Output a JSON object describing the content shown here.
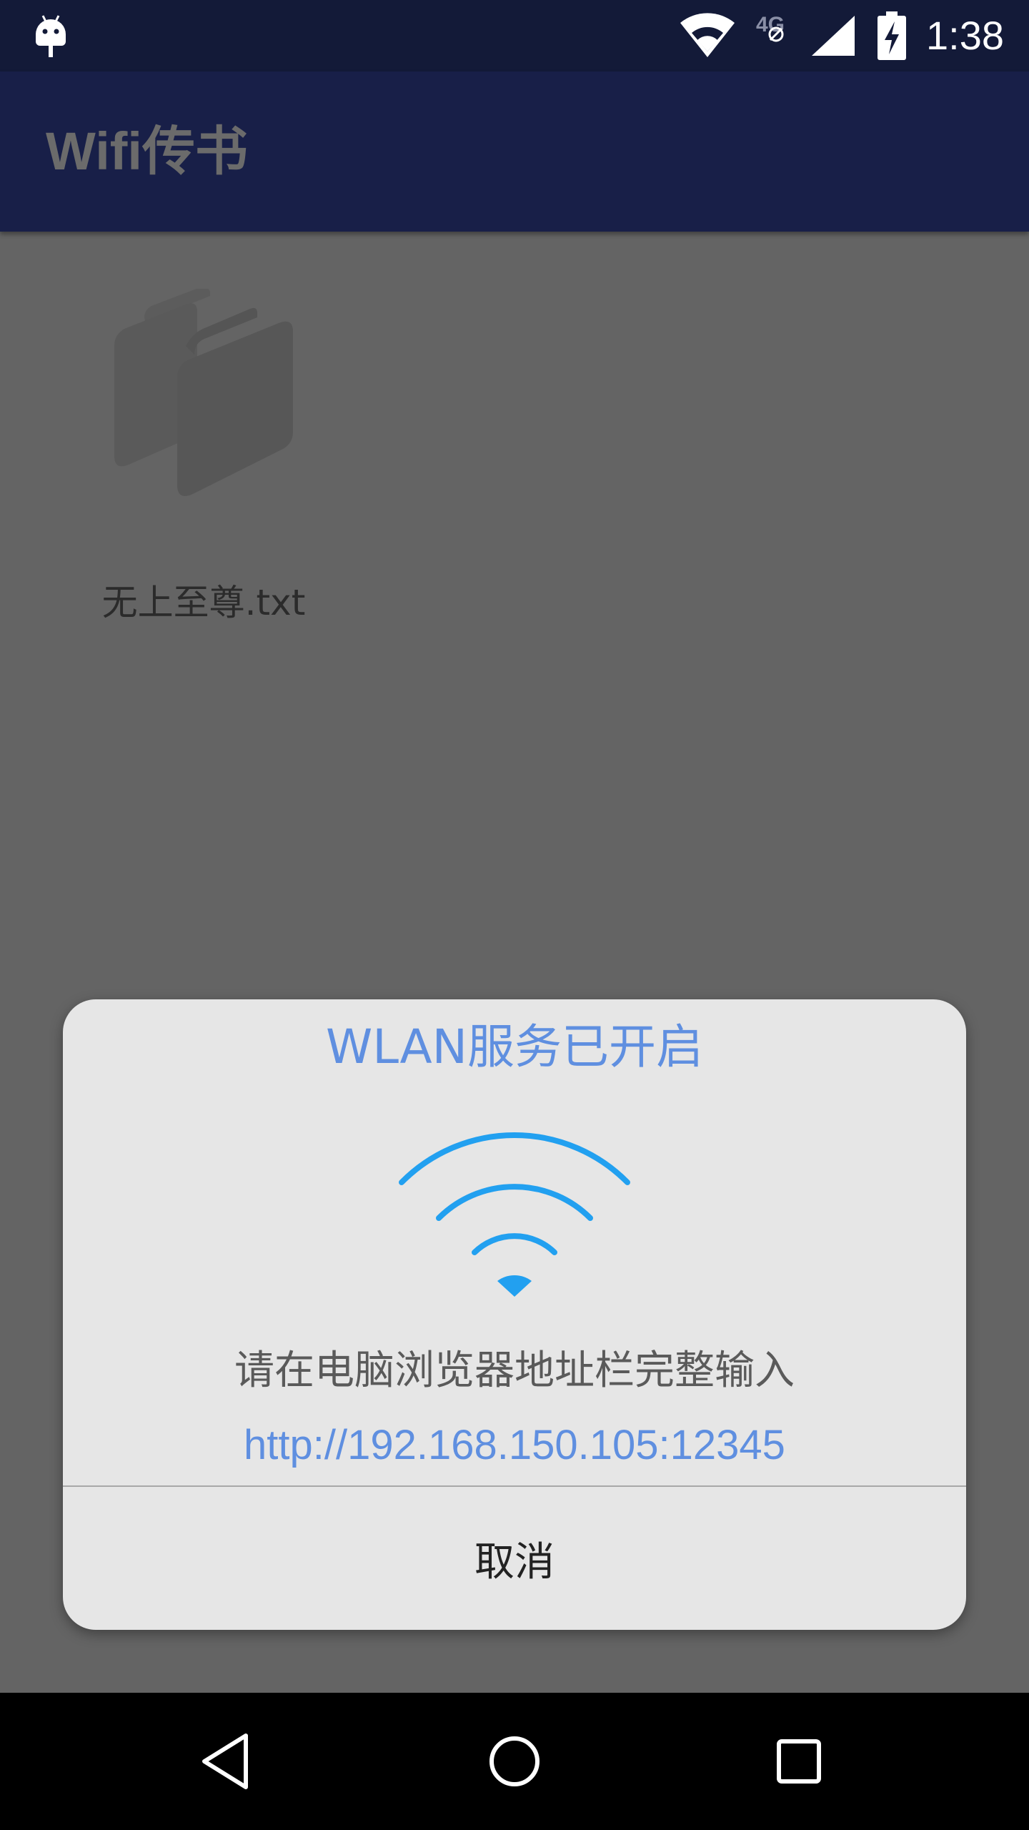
{
  "status_bar": {
    "time": "1:38",
    "network_label": "4G",
    "icons": [
      "android-icon",
      "wifi-icon",
      "no-data-icon",
      "cell-signal-icon",
      "battery-charging-icon"
    ]
  },
  "app_bar": {
    "title": "Wifi传书"
  },
  "files": [
    {
      "name": "无上至尊.txt",
      "icon": "book-icon"
    }
  ],
  "dialog": {
    "title": "WLAN服务已开启",
    "icon": "wifi-icon",
    "message": "请在电脑浏览器地址栏完整输入",
    "url": "http://192.168.150.105:12345",
    "cancel_label": "取消"
  },
  "nav_bar": {
    "buttons": [
      "back-icon",
      "home-icon",
      "recents-icon"
    ]
  },
  "colors": {
    "status_bar": "#131a38",
    "app_bar": "#181f48",
    "accent_blue": "#5f8fe0",
    "wifi_icon": "#22a0f0",
    "dialog_bg": "#e6e6e6",
    "scrim_content": "#646464"
  }
}
